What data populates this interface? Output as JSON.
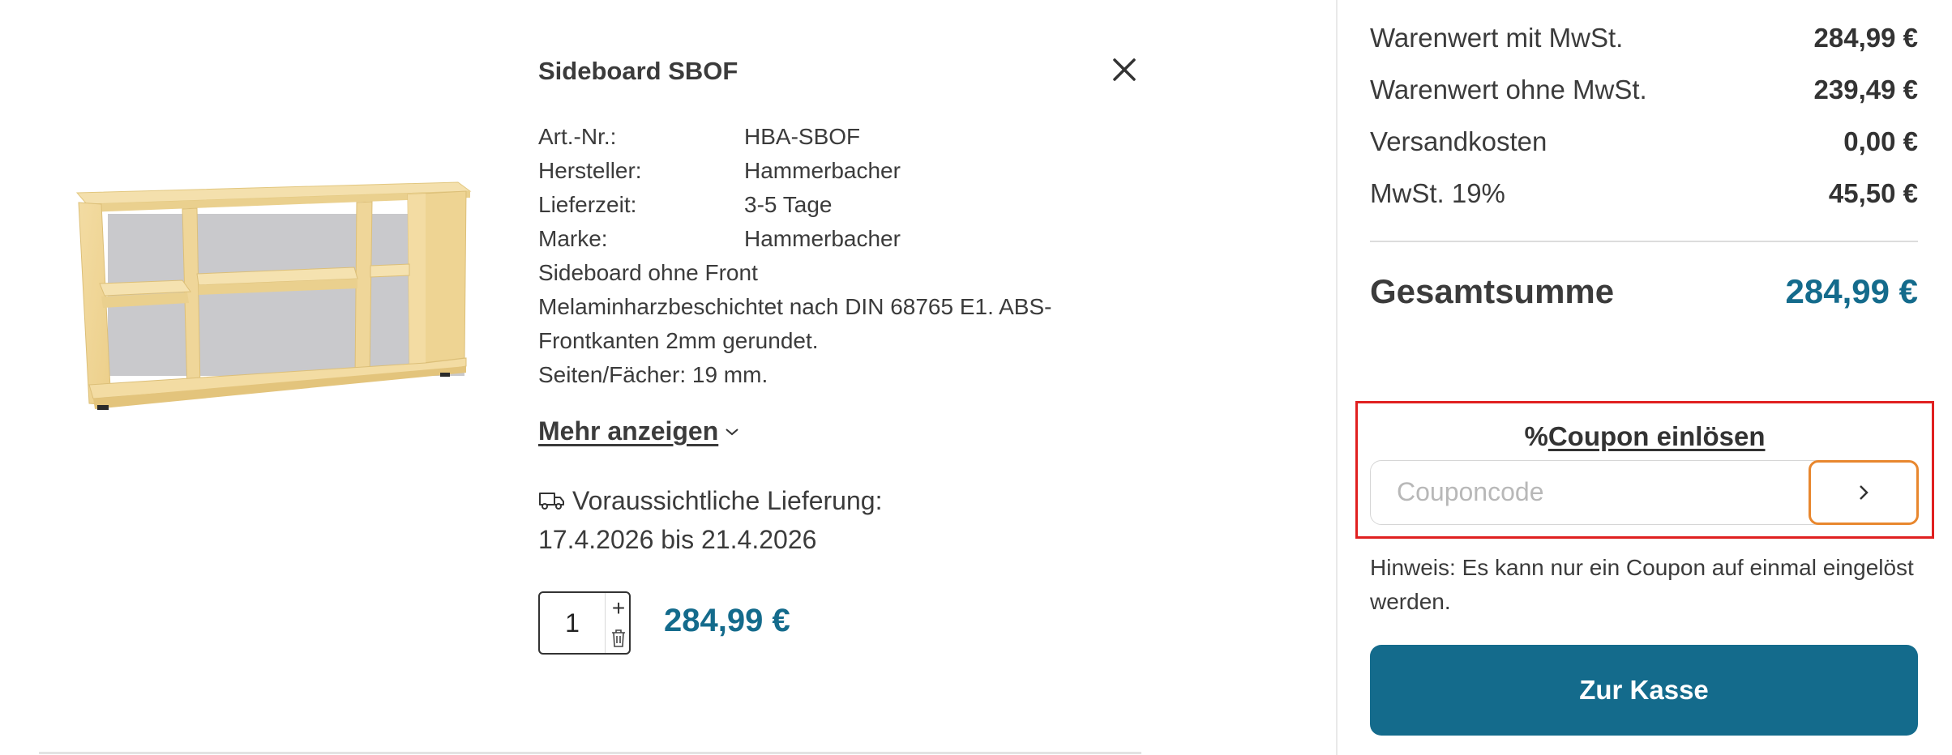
{
  "product": {
    "title": "Sideboard SBOF",
    "image_alt": "sideboard-image",
    "specs": [
      {
        "label": "Art.-Nr.:",
        "value": "HBA-SBOF"
      },
      {
        "label": "Hersteller:",
        "value": "Hammerbacher"
      },
      {
        "label": "Lieferzeit:",
        "value": "3-5 Tage"
      },
      {
        "label": "Marke:",
        "value": "Hammerbacher"
      }
    ],
    "description": [
      "Sideboard ohne Front",
      "Melaminharzbeschichtet nach DIN 68765 E1. ABS-",
      "Frontkanten 2mm gerundet.",
      "Seiten/Fächer: 19 mm."
    ],
    "more_label": "Mehr anzeigen",
    "delivery_label": "Voraussichtliche Lieferung:",
    "delivery_range": "17.4.2026 bis 21.4.2026",
    "quantity": "1",
    "price": "284,99 €"
  },
  "summary": {
    "rows": [
      {
        "label": "Warenwert mit MwSt.",
        "value": "284,99 €"
      },
      {
        "label": "Warenwert ohne MwSt.",
        "value": "239,49 €"
      },
      {
        "label": "Versandkosten",
        "value": "0,00 €"
      },
      {
        "label": "MwSt. 19%",
        "value": "45,50 €"
      }
    ],
    "total_label": "Gesamtsumme",
    "total_value": "284,99 €"
  },
  "coupon": {
    "percent_symbol": "%",
    "title": "Coupon einlösen",
    "placeholder": "Couponcode",
    "hint": "Hinweis: Es kann nur ein Coupon auf einmal eingelöst werden."
  },
  "checkout_label": "Zur Kasse",
  "colors": {
    "accent": "#146b8c",
    "coupon_highlight": "#e02020",
    "submit_border": "#e8872e"
  }
}
